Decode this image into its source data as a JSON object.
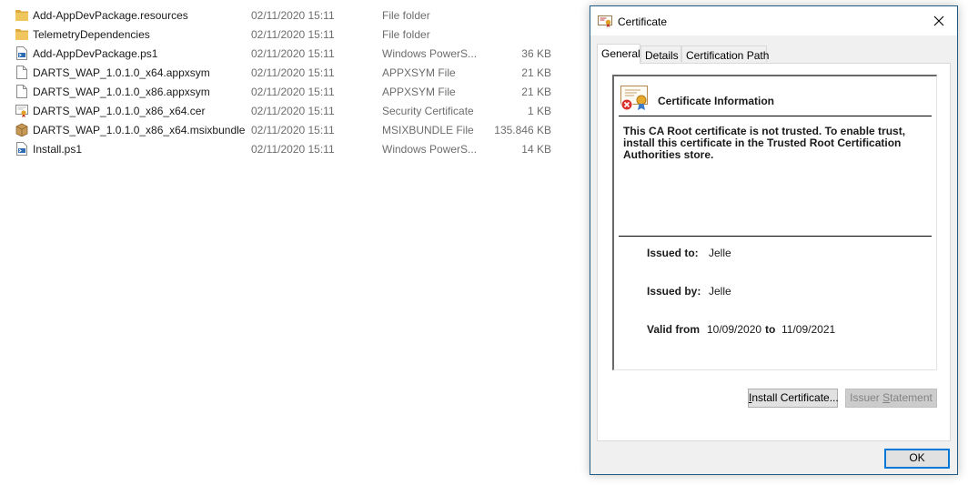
{
  "files": [
    {
      "name": "Add-AppDevPackage.resources",
      "date": "02/11/2020 15:11",
      "type": "File folder",
      "size": "",
      "icon": "folder-icon"
    },
    {
      "name": "TelemetryDependencies",
      "date": "02/11/2020 15:11",
      "type": "File folder",
      "size": "",
      "icon": "folder-icon"
    },
    {
      "name": "Add-AppDevPackage.ps1",
      "date": "02/11/2020 15:11",
      "type": "Windows PowerS...",
      "size": "36 KB",
      "icon": "powershell-file-icon"
    },
    {
      "name": "DARTS_WAP_1.0.1.0_x64.appxsym",
      "date": "02/11/2020 15:11",
      "type": "APPXSYM File",
      "size": "21 KB",
      "icon": "blank-file-icon"
    },
    {
      "name": "DARTS_WAP_1.0.1.0_x86.appxsym",
      "date": "02/11/2020 15:11",
      "type": "APPXSYM File",
      "size": "21 KB",
      "icon": "blank-file-icon"
    },
    {
      "name": "DARTS_WAP_1.0.1.0_x86_x64.cer",
      "date": "02/11/2020 15:11",
      "type": "Security Certificate",
      "size": "1 KB",
      "icon": "certificate-file-icon"
    },
    {
      "name": "DARTS_WAP_1.0.1.0_x86_x64.msixbundle",
      "date": "02/11/2020 15:11",
      "type": "MSIXBUNDLE File",
      "size": "135.846 KB",
      "icon": "package-file-icon"
    },
    {
      "name": "Install.ps1",
      "date": "02/11/2020 15:11",
      "type": "Windows PowerS...",
      "size": "14 KB",
      "icon": "powershell-file-icon"
    }
  ],
  "dialog": {
    "title": "Certificate",
    "tabs": [
      "General",
      "Details",
      "Certification Path"
    ],
    "active_tab": "General",
    "info_title": "Certificate Information",
    "warning": "This CA Root certificate is not trusted. To enable trust, install this certificate in the Trusted Root Certification Authorities store.",
    "issued_to_label": "Issued to:",
    "issued_to": "Jelle",
    "issued_by_label": "Issued by:",
    "issued_by": "Jelle",
    "valid_from_label": "Valid from",
    "valid_from": "10/09/2020",
    "to_label": "to",
    "valid_to": "11/09/2021",
    "install_button": {
      "mnemonic": "I",
      "rest": "nstall Certificate..."
    },
    "issuer_button": {
      "before": "Issuer ",
      "mnemonic": "S",
      "after": "tatement"
    },
    "ok_label": "OK"
  },
  "colors": {
    "accent": "#0078d7",
    "folder": "#e8b84a",
    "dialog_border": "#1f5c86"
  }
}
